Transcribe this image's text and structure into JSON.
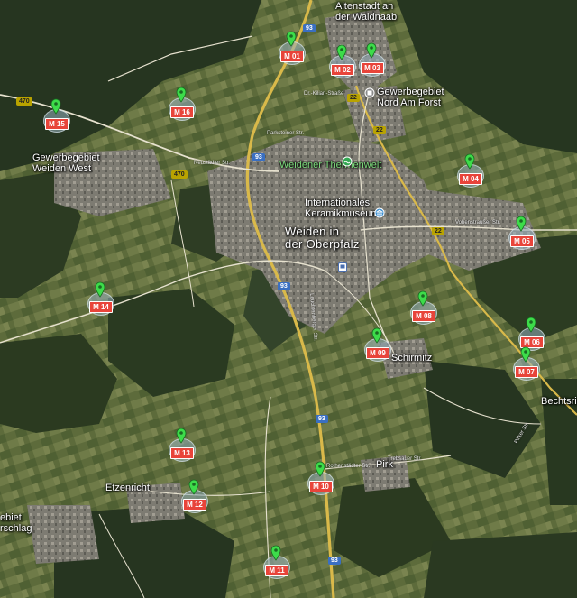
{
  "places": {
    "altenstadt": "Altenstadt an\nder Waldnaab",
    "gewerbe_nord": "Gewerbegebiet\nNord Am Forst",
    "gewerbe_west": "Gewerbegebiet\nWeiden West",
    "therme": "Weidener Thermenwelt",
    "museum": "Internationales\nKeramikmuseum",
    "weiden": "Weiden in\nder Oberpfalz",
    "schirmitz": "Schirmitz",
    "pirk": "Pirk",
    "etzenricht": "Etzenricht",
    "bechtsrieth": "Bechtsrie",
    "gewerbe_sw": "ebiet\nrschlag"
  },
  "road_shields": {
    "b470_w": "470",
    "b470_c": "470",
    "a93_n": "93",
    "a93_c": "93",
    "a93_m": "93",
    "a93_s": "93",
    "a93_ss": "93",
    "b22_n": "22",
    "b22_c": "22",
    "b22_e": "22"
  },
  "streets": {
    "kilian": "Dr.-Kilian-Straße",
    "parkstein": "Parksteiner Str.",
    "neustaedter": "Neustädter Str.",
    "leuchtenberger": "Leuchtenberger Str.",
    "vohenstraussl": "Vohenstraußer Str.",
    "rothenstaedter": "Rothenstädter Str.",
    "trebsauer": "Trebsauer Str.",
    "pirker": "Pirker Str."
  },
  "markers": [
    {
      "label": "M 01"
    },
    {
      "label": "M 02"
    },
    {
      "label": "M 03"
    },
    {
      "label": "M 04"
    },
    {
      "label": "M 05"
    },
    {
      "label": "M 06"
    },
    {
      "label": "M 07"
    },
    {
      "label": "M 08"
    },
    {
      "label": "M 09"
    },
    {
      "label": "M 10"
    },
    {
      "label": "M 11"
    },
    {
      "label": "M 12"
    },
    {
      "label": "M 13"
    },
    {
      "label": "M 14"
    },
    {
      "label": "M 15"
    },
    {
      "label": "M 16"
    }
  ],
  "colors": {
    "forest": "#2b3a20",
    "field": "#5b6a3a",
    "urban": "#8d8a82",
    "motorway": "#d9b94a",
    "road": "#e7e2cf",
    "marker_pin": "#3ddc4a",
    "marker_label": "#e8443a"
  },
  "icons": {
    "map_pin": "map-pin-icon",
    "museum": "museum-icon",
    "therme": "pool-icon",
    "train": "train-station-icon",
    "poi": "poi-icon"
  }
}
